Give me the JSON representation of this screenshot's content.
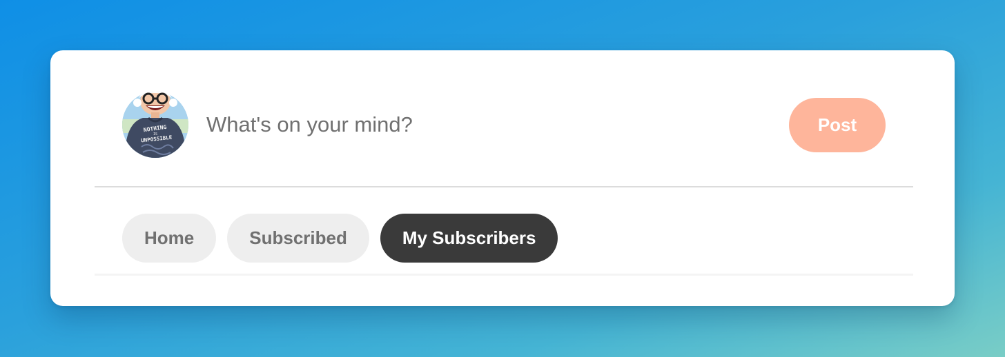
{
  "composer": {
    "placeholder": "What's on your mind?",
    "post_label": "Post",
    "avatar_alt": "User avatar",
    "avatar_shirt_text": [
      "NOTHING",
      "IS",
      "UNPOSSIBLE"
    ]
  },
  "tabs": [
    {
      "label": "Home",
      "active": false
    },
    {
      "label": "Subscribed",
      "active": false
    },
    {
      "label": "My Subscribers",
      "active": true
    }
  ],
  "colors": {
    "post_button": "#feb59b",
    "active_tab": "#3a3a3a",
    "inactive_tab": "#eeeeee"
  }
}
